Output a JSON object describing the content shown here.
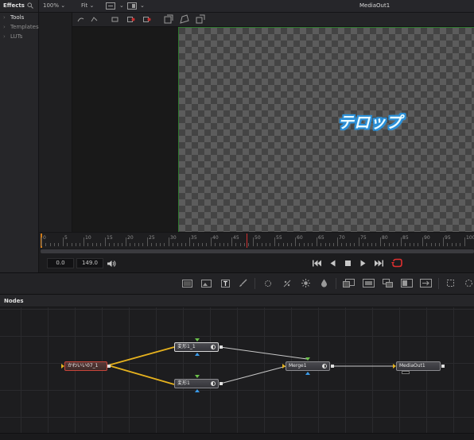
{
  "effects": {
    "title": "Effects",
    "search_icon": "search-icon",
    "items": [
      {
        "label": "Tools",
        "active": true
      },
      {
        "label": "Templates",
        "active": false
      },
      {
        "label": "LUTs",
        "active": false
      }
    ]
  },
  "viewer": {
    "zoom": "100%",
    "fit": "Fit",
    "title": "MediaOut1",
    "caption": "テロップ"
  },
  "ruler": {
    "ticks": [
      "0",
      "5",
      "10",
      "15",
      "20",
      "25",
      "30",
      "35",
      "40",
      "45",
      "50",
      "55",
      "60",
      "65",
      "70",
      "75",
      "80",
      "85",
      "90",
      "95",
      "100"
    ]
  },
  "transport": {
    "start": "0.0",
    "end": "149.0",
    "loop_color": "#e03030"
  },
  "nodes_panel": {
    "title": "Nodes"
  },
  "nodes": {
    "source": "かわいい07_1",
    "transform_a": "変形1_1",
    "transform_b": "変形1",
    "merge": "Merge1",
    "output": "MediaOut1"
  },
  "colors": {
    "link_yellow": "#e6b21e",
    "link_white": "#c8c8c8",
    "green_port": "#6cc24a",
    "blue_port": "#3a9ae8",
    "canvas_border": "#2f7a2f",
    "caption_outline": "#2a8fd8"
  }
}
